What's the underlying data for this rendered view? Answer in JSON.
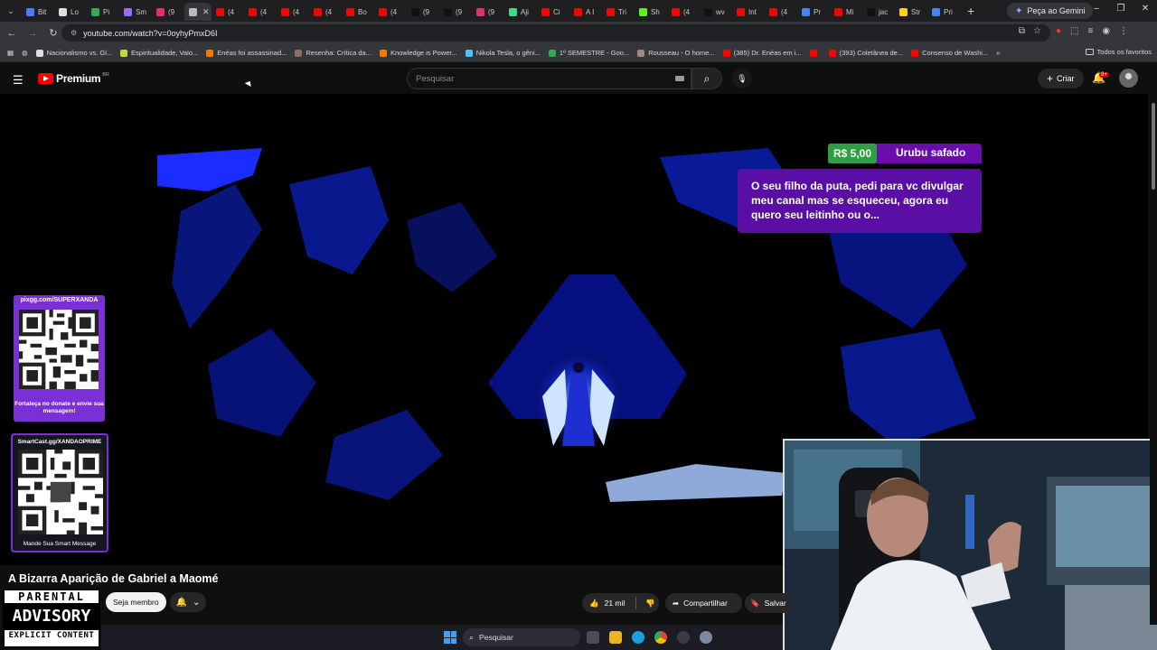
{
  "browser": {
    "tabs": [
      {
        "label": "Bit",
        "color": "#4a7cff"
      },
      {
        "label": "Lo",
        "color": "#dddddd"
      },
      {
        "label": "Pi",
        "color": "#34a853"
      },
      {
        "label": "Sm",
        "color": "#9b6dff"
      },
      {
        "label": "(9",
        "color": "#e1306c"
      },
      {
        "label": "",
        "color": "#bbbbbb",
        "active": true
      },
      {
        "label": "(4",
        "color": "#ff0000"
      },
      {
        "label": "(4",
        "color": "#ff0000"
      },
      {
        "label": "(4",
        "color": "#ff0000"
      },
      {
        "label": "(4",
        "color": "#ff0000"
      },
      {
        "label": "Bo",
        "color": "#ff0000"
      },
      {
        "label": "(4",
        "color": "#ff0000"
      },
      {
        "label": "(9",
        "color": "#111111"
      },
      {
        "label": "(9",
        "color": "#111111"
      },
      {
        "label": "(9",
        "color": "#e1306c"
      },
      {
        "label": "Aji",
        "color": "#3ddc84"
      },
      {
        "label": "Ci",
        "color": "#ff0000"
      },
      {
        "label": "A I",
        "color": "#ff0000"
      },
      {
        "label": "Tri",
        "color": "#ff0000"
      },
      {
        "label": "Sh",
        "color": "#53fc18"
      },
      {
        "label": "(4",
        "color": "#ff0000"
      },
      {
        "label": "wv",
        "color": "#111111"
      },
      {
        "label": "Int",
        "color": "#ff0000"
      },
      {
        "label": "(4",
        "color": "#ff0000"
      },
      {
        "label": "Pr",
        "color": "#4285f4"
      },
      {
        "label": "Mi",
        "color": "#ff0000"
      },
      {
        "label": "jac",
        "color": "#111111"
      },
      {
        "label": "Str",
        "color": "#ffd400"
      },
      {
        "label": "Pri",
        "color": "#4285f4"
      }
    ],
    "gemini_label": "Peça ao Gemini",
    "url": "youtube.com/watch?v=0oyhyPmxD6I",
    "bookmarks": [
      {
        "label": "Nacionalismo vs. Gl...",
        "color": "#dddddd"
      },
      {
        "label": "Espiritualidade, Valo...",
        "color": "#c6d83a"
      },
      {
        "label": "Enéas foi assassinad...",
        "color": "#f57c00"
      },
      {
        "label": "Resenha: Crítica da...",
        "color": "#8d6e63"
      },
      {
        "label": "Knowledge is Power...",
        "color": "#f57c00"
      },
      {
        "label": "Nikola Tesla, o gêni...",
        "color": "#4fc3f7"
      },
      {
        "label": "1º SEMESTRE - Goo...",
        "color": "#34a853"
      },
      {
        "label": "Rousseau - O home...",
        "color": "#a1887f"
      },
      {
        "label": "(385) Dr. Enéas em i...",
        "color": "#ff0000"
      },
      {
        "label": "",
        "color": "#ff0000"
      },
      {
        "label": "(393) Coletânea de...",
        "color": "#ff0000"
      },
      {
        "label": "Consenso de Washi...",
        "color": "#ff0000"
      }
    ],
    "all_bookmarks": "Todos os favoritos"
  },
  "youtube": {
    "logo_word": "Premium",
    "logo_region": "BR",
    "search_placeholder": "Pesquisar",
    "create_label": "Criar",
    "notif_badge": "9+",
    "video_title": "A Bizarra Aparição de Gabriel a Maomé",
    "member_label": "Seja membro",
    "likes": "21 mil",
    "share_label": "Compartilhar",
    "save_label": "Salvar"
  },
  "superchat": {
    "amount": "R$ 5,00",
    "name": "Urubu safado",
    "message": "O seu filho da puta, pedi para vc divulgar meu canal mas se esqueceu, agora eu quero seu leitinho ou o...",
    "color": "#5b0ea6"
  },
  "overlays": {
    "qr1_top": "pixgg.com/SUPERXANDA",
    "qr1_bottom": "Fortaleça no donate e envie sua mensagem!",
    "qr2_top": "SmartCast.gg/XANDAOPRIME",
    "qr2_bottom": "Mande Sua Smart Message",
    "advisory_line1": "PARENTAL",
    "advisory_line2": "ADVISORY",
    "advisory_line3": "EXPLICIT CONTENT"
  },
  "taskbar": {
    "search_placeholder": "Pesquisar"
  }
}
